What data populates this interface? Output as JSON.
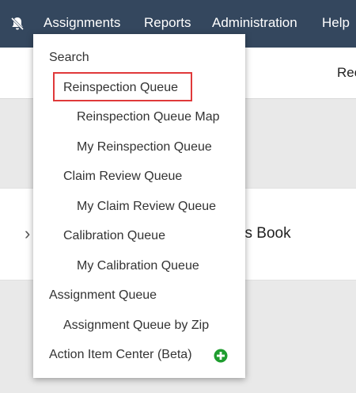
{
  "topnav": {
    "items": [
      {
        "label": "Assignments"
      },
      {
        "label": "Reports"
      },
      {
        "label": "Administration"
      },
      {
        "label": "Help"
      }
    ]
  },
  "subbar": {
    "text": "Rec"
  },
  "card": {
    "title_fragment": "ss Book"
  },
  "dropdown": {
    "items": [
      {
        "label": "Search",
        "level": 0
      },
      {
        "label": "Reinspection Queue",
        "level": 1,
        "highlighted": true
      },
      {
        "label": "Reinspection Queue Map",
        "level": 2
      },
      {
        "label": "My Reinspection Queue",
        "level": 2
      },
      {
        "label": "Claim Review Queue",
        "level": 1
      },
      {
        "label": "My Claim Review Queue",
        "level": 2
      },
      {
        "label": "Calibration Queue",
        "level": 1
      },
      {
        "label": "My Calibration Queue",
        "level": 2
      },
      {
        "label": "Assignment Queue",
        "level": 0
      },
      {
        "label": "Assignment Queue by Zip",
        "level": 1
      },
      {
        "label": "Action Item Center (Beta)",
        "level": 0,
        "icon": "plus-circle-icon"
      }
    ]
  },
  "colors": {
    "nav_bg": "#34475e",
    "highlight_border": "#e0393a",
    "plus_icon": "#1f9d2f"
  }
}
